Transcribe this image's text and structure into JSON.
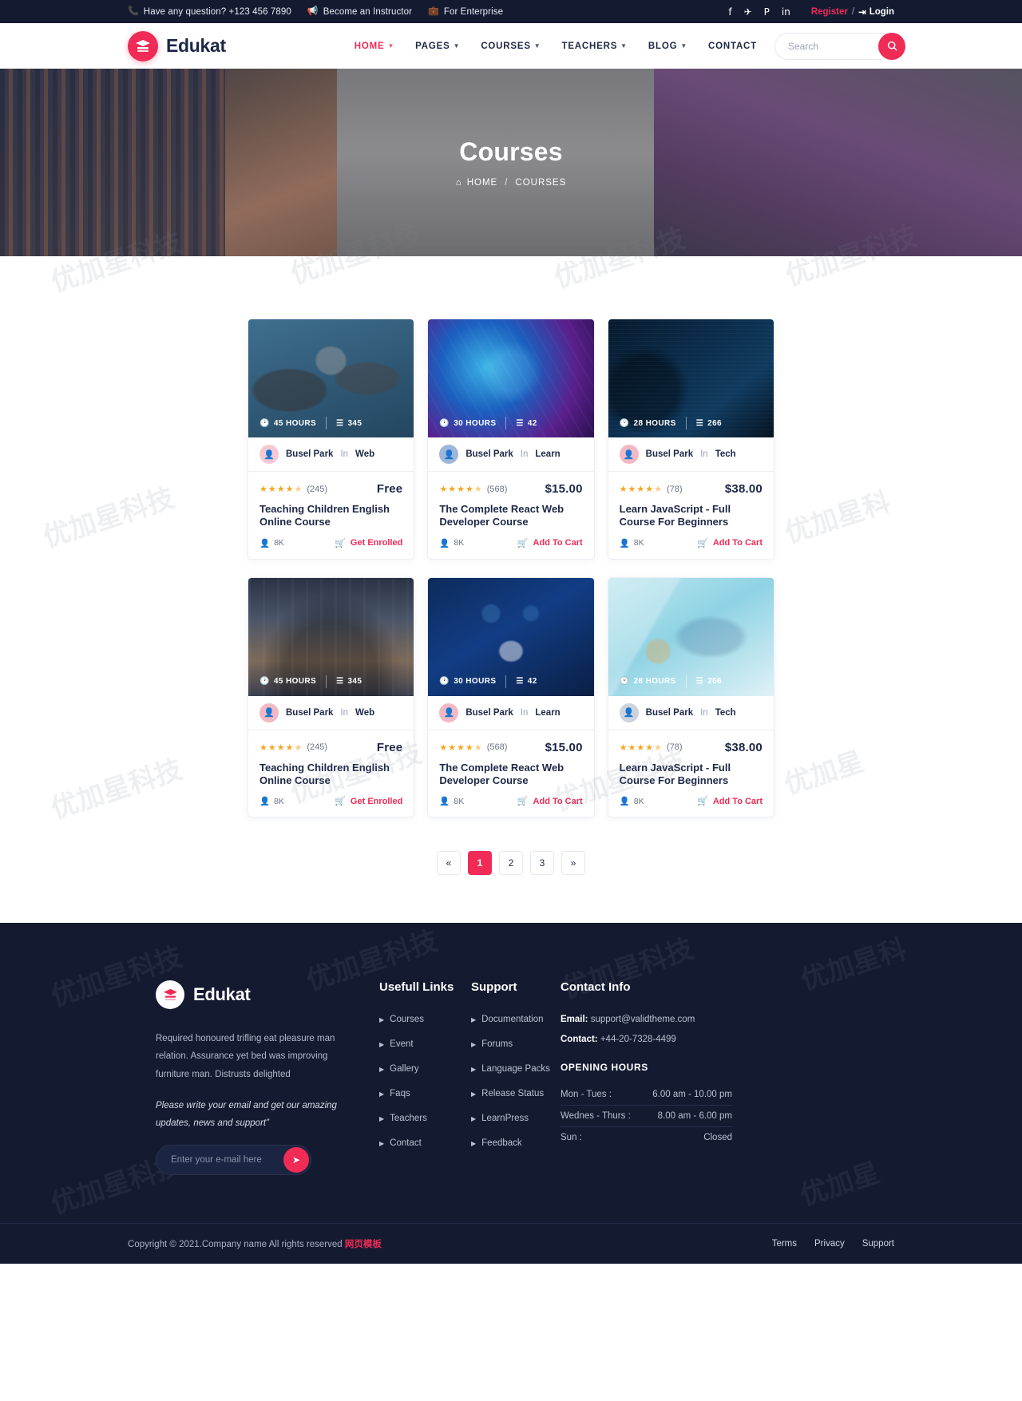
{
  "topbar": {
    "phone_text": "Have any question? +123 456 7890",
    "instructor_text": "Become an Instructor",
    "enterprise_text": "For Enterprise",
    "socials": [
      {
        "name": "facebook-icon",
        "glyph": "f"
      },
      {
        "name": "twitter-icon",
        "glyph": "✈"
      },
      {
        "name": "pinterest-icon",
        "glyph": "P"
      },
      {
        "name": "linkedin-icon",
        "glyph": "in"
      }
    ],
    "register_label": "Register",
    "separator": "/",
    "login_label": "Login"
  },
  "nav": {
    "brand": "Edukat",
    "items": [
      {
        "label": "HOME",
        "has_caret": true,
        "active": true
      },
      {
        "label": "PAGES",
        "has_caret": true,
        "active": false
      },
      {
        "label": "COURSES",
        "has_caret": true,
        "active": false
      },
      {
        "label": "TEACHERS",
        "has_caret": true,
        "active": false
      },
      {
        "label": "BLOG",
        "has_caret": true,
        "active": false
      },
      {
        "label": "CONTACT",
        "has_caret": false,
        "active": false
      }
    ],
    "search_placeholder": "Search",
    "search_value": ""
  },
  "hero": {
    "title": "Courses",
    "breadcrumb_home": "HOME",
    "breadcrumb_sep": "/",
    "breadcrumb_current": "COURSES"
  },
  "courses": [
    {
      "thumb_class": "thumb-a",
      "hours": "45 HOURS",
      "lessons": "345",
      "author": "Busel Park",
      "in_word": "In",
      "category": "Web",
      "avatar_class": "av-pink",
      "rating_count": "(245)",
      "price": "Free",
      "title": "Teaching Children English Online Course",
      "students": "8K",
      "cta": "Get Enrolled"
    },
    {
      "thumb_class": "thumb-b",
      "hours": "30 HOURS",
      "lessons": "42",
      "author": "Busel Park",
      "in_word": "In",
      "category": "Learn",
      "avatar_class": "av-blue",
      "rating_count": "(568)",
      "price": "$15.00",
      "title": "The Complete React Web Developer Course",
      "students": "8K",
      "cta": "Add To Cart"
    },
    {
      "thumb_class": "thumb-c",
      "hours": "28 HOURS",
      "lessons": "266",
      "author": "Busel Park",
      "in_word": "In",
      "category": "Tech",
      "avatar_class": "av-rose",
      "rating_count": "(78)",
      "price": "$38.00",
      "title": "Learn JavaScript - Full Course For Beginners",
      "students": "8K",
      "cta": "Add To Cart"
    },
    {
      "thumb_class": "thumb-d",
      "hours": "45 HOURS",
      "lessons": "345",
      "author": "Busel Park",
      "in_word": "In",
      "category": "Web",
      "avatar_class": "av-rose",
      "rating_count": "(245)",
      "price": "Free",
      "title": "Teaching Children English Online Course",
      "students": "8K",
      "cta": "Get Enrolled"
    },
    {
      "thumb_class": "thumb-e",
      "hours": "30 HOURS",
      "lessons": "42",
      "author": "Busel Park",
      "in_word": "In",
      "category": "Learn",
      "avatar_class": "av-rose",
      "rating_count": "(568)",
      "price": "$15.00",
      "title": "The Complete React Web Developer Course",
      "students": "8K",
      "cta": "Add To Cart"
    },
    {
      "thumb_class": "thumb-f",
      "hours": "28 HOURS",
      "lessons": "266",
      "author": "Busel Park",
      "in_word": "In",
      "category": "Tech",
      "avatar_class": "av-gray",
      "rating_count": "(78)",
      "price": "$38.00",
      "title": "Learn JavaScript - Full Course For Beginners",
      "students": "8K",
      "cta": "Add To Cart"
    }
  ],
  "pagination": {
    "prev": "«",
    "pages": [
      "1",
      "2",
      "3"
    ],
    "active_page": "1",
    "next": "»"
  },
  "footer": {
    "brand": "Edukat",
    "description": "Required honoured trifling eat pleasure man relation. Assurance yet bed was improving furniture man. Distrusts delighted",
    "note": "Please write your email and get our amazing updates, news and support”",
    "subscribe_placeholder": "Enter your e-mail here",
    "subscribe_value": "",
    "useful_links_head": "Usefull Links",
    "useful_links": [
      "Courses",
      "Event",
      "Gallery",
      "Faqs",
      "Teachers",
      "Contact"
    ],
    "support_head": "Support",
    "support_links": [
      "Documentation",
      "Forums",
      "Language Packs",
      "Release Status",
      "LearnPress",
      "Feedback"
    ],
    "contact_head": "Contact Info",
    "email_label": "Email:",
    "email_value": "support@validtheme.com",
    "contact_label": "Contact:",
    "contact_value": "+44-20-7328-4499",
    "hours_head": "OPENING HOURS",
    "hours": [
      {
        "day": "Mon - Tues :",
        "time": "6.00 am - 10.00 pm"
      },
      {
        "day": "Wednes - Thurs :",
        "time": "8.00 am - 6.00 pm"
      },
      {
        "day": "Sun :",
        "time": "Closed"
      }
    ],
    "copyright": "Copyright © 2021.Company name All rights reserved",
    "copyright_link": "网页模板",
    "bottom_links": [
      "Terms",
      "Privacy",
      "Support"
    ]
  },
  "colors": {
    "accent": "#ef2b56",
    "dark": "#141b31",
    "star": "#f5a623"
  }
}
